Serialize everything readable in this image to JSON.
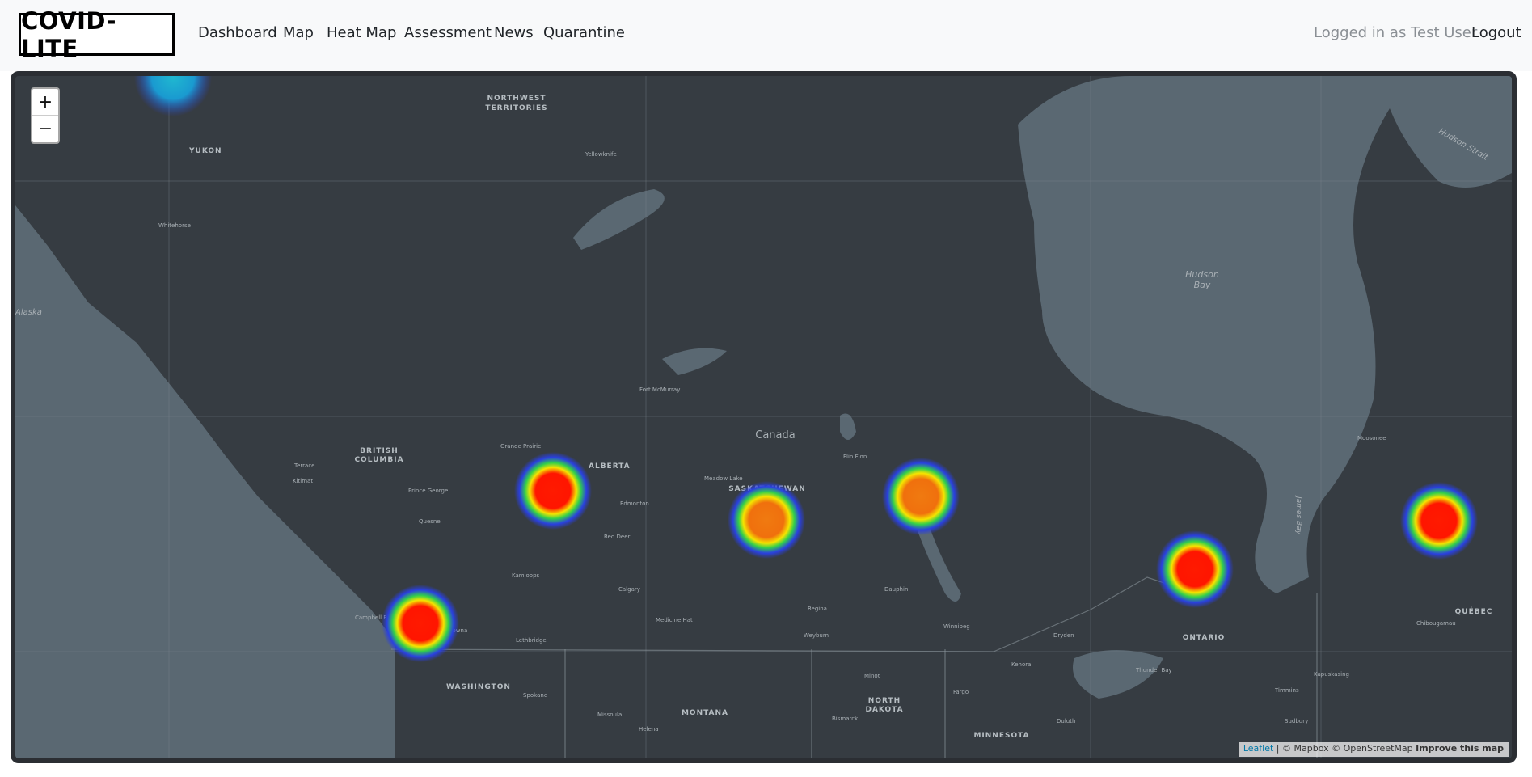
{
  "brand": {
    "text": "COVID-LITE"
  },
  "nav": {
    "links": [
      "Dashboard",
      "Map",
      "Heat Map",
      "Assessment",
      "News",
      "Quarantine"
    ],
    "user_status": "Logged in as Test User",
    "logout": "Logout"
  },
  "map": {
    "zoom_in": "+",
    "zoom_out": "−",
    "labels": {
      "nwt_1": "NORTHWEST",
      "nwt_2": "TERRITORIES",
      "yukon": "YUKON",
      "canada": "Canada",
      "bc_1": "BRITISH",
      "bc_2": "COLUMBIA",
      "alberta": "ALBERTA",
      "saskatchewan": "SASKATCHEWAN",
      "ontario": "ONTARIO",
      "quebec": "QUÉBEC",
      "washington": "WASHINGTON",
      "montana": "MONTANA",
      "nd_1": "NORTH",
      "nd_2": "DAKOTA",
      "minnesota": "MINNESOTA",
      "hudson_1": "Hudson",
      "hudson_2": "Bay",
      "hudson_strait": "Hudson Strait",
      "edmonton": "Edmonton",
      "calgary": "Calgary",
      "regina": "Regina",
      "winnipeg": "Winnipeg",
      "prince_george": "Prince George",
      "grande_prairie": "Grande Prairie",
      "yellowknife": "Yellowknife",
      "fort_mcmurray": "Fort McMurray",
      "whitehorse": "Whitehorse",
      "kamloops": "Kamloops",
      "campbell_river": "Campbell River",
      "spokane": "Spokane",
      "lethbridge": "Lethbridge",
      "medicine_hat": "Medicine Hat",
      "weyburn": "Weyburn",
      "thunder_bay": "Thunder Bay",
      "quesnel": "Quesnel",
      "terrace": "Terrace",
      "kitimat": "Kitimat",
      "meadow_lake": "Meadow Lake",
      "flin_flon": "Flin Flon",
      "dauphin": "Dauphin",
      "kelowna": "Kelowna",
      "missoula": "Missoula",
      "helena": "Helena",
      "minot": "Minot",
      "bismarck": "Bismarck",
      "fargo": "Fargo",
      "duluth": "Duluth",
      "red_deer": "Red Deer",
      "timmins": "Timmins",
      "sudbury": "Sudbury",
      "chibougamau": "Chibougamau",
      "kapuskasing": "Kapuskasing",
      "kenora": "Kenora",
      "dryden": "Dryden",
      "moosonee": "Moosonee",
      "alaska": "Alaska",
      "james_bay": "James Bay"
    },
    "hotspot_colors": {
      "core_red": "#ff1a00",
      "core_orange": "#f07a10",
      "ring_yellow": "#f5e400",
      "ring_green": "#32d04a",
      "ring_blue": "#2a40e0"
    },
    "attribution": {
      "leaflet": "Leaflet",
      "mapbox": " | © Mapbox © OpenStreetMap ",
      "improve": "Improve this map"
    }
  }
}
